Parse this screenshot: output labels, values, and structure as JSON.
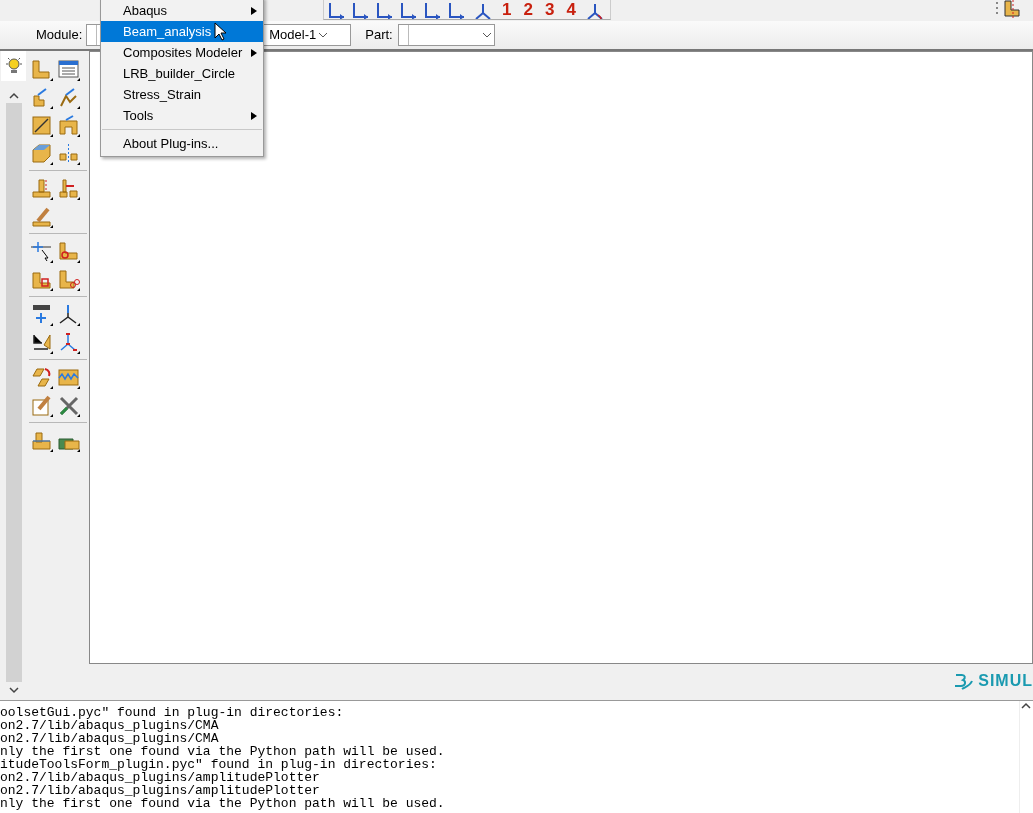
{
  "toolbar": {
    "number_buttons": [
      "1",
      "2",
      "3",
      "4"
    ]
  },
  "context_bar": {
    "module": {
      "label": "Module:"
    },
    "model": {
      "value": "Model-1"
    },
    "part": {
      "label": "Part:"
    }
  },
  "plugins_menu": {
    "items": [
      {
        "kind": "item",
        "label": "Abaqus",
        "selected": false,
        "submenu": true
      },
      {
        "kind": "item",
        "label": "Beam_analysis",
        "selected": true,
        "submenu": false
      },
      {
        "kind": "item",
        "label": "Composites Modeler",
        "selected": false,
        "submenu": true
      },
      {
        "kind": "item",
        "label": "LRB_builder_Circle",
        "selected": false,
        "submenu": false
      },
      {
        "kind": "item",
        "label": "Stress_Strain",
        "selected": false,
        "submenu": false
      },
      {
        "kind": "item",
        "label": "Tools",
        "selected": false,
        "submenu": true
      },
      {
        "kind": "separator"
      },
      {
        "kind": "item",
        "label": "About Plug-ins...",
        "selected": false,
        "submenu": false
      }
    ]
  },
  "brand": {
    "text": "SIMUL"
  },
  "message_area": {
    "lines": [
      "oolsetGui.pyc\" found in plug-in directories:",
      "on2.7/lib/abaqus_plugins/CMA",
      "on2.7/lib/abaqus_plugins/CMA",
      "nly the first one found via the Python path will be used.",
      "itudeToolsForm_plugin.pyc\" found in plug-in directories:",
      "on2.7/lib/abaqus_plugins/amplitudePlotter",
      "on2.7/lib/abaqus_plugins/amplitudePlotter",
      "nly the first one found via the Python path will be used."
    ]
  }
}
